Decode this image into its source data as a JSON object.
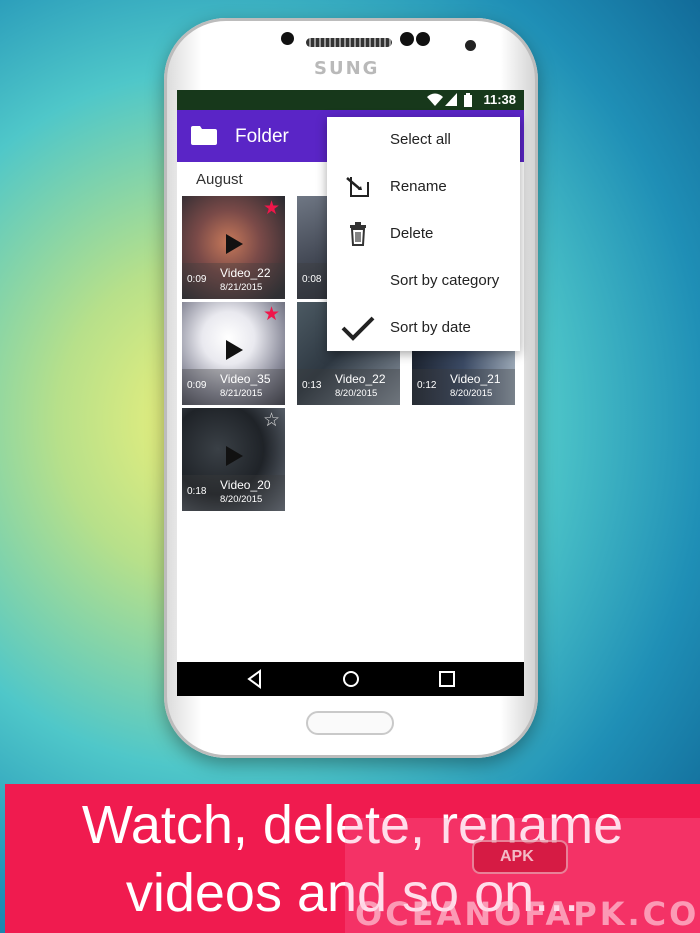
{
  "device": {
    "brand": "SUNG"
  },
  "status_bar": {
    "time": "11:38",
    "icons": [
      "wifi-icon",
      "signal-icon",
      "battery-icon"
    ]
  },
  "app_bar": {
    "title": "Folder",
    "icon": "folder-icon"
  },
  "section": {
    "label": "August"
  },
  "videos": [
    {
      "name": "Video_22",
      "date": "8/21/2015",
      "duration": "0:09",
      "starred": true
    },
    {
      "name": "",
      "date": "",
      "duration": "0:08",
      "starred": false
    },
    {
      "name": "Video_35",
      "date": "8/21/2015",
      "duration": "0:09",
      "starred": true
    },
    {
      "name": "Video_22",
      "date": "8/20/2015",
      "duration": "0:13",
      "starred": false
    },
    {
      "name": "Video_21",
      "date": "8/20/2015",
      "duration": "0:12",
      "starred": false
    },
    {
      "name": "Video_20",
      "date": "8/20/2015",
      "duration": "0:18",
      "starred": false
    }
  ],
  "menu": {
    "items": [
      {
        "label": "Select all",
        "icon": ""
      },
      {
        "label": "Rename",
        "icon": "rename-icon"
      },
      {
        "label": "Delete",
        "icon": "trash-icon"
      },
      {
        "label": "Sort by category",
        "icon": ""
      },
      {
        "label": "Sort by date",
        "icon": "checkmark-icon",
        "checked": true
      }
    ]
  },
  "nav_bar": {
    "buttons": [
      "back-icon",
      "home-icon",
      "recents-icon"
    ]
  },
  "banner": {
    "line1": "Watch, delete, rename",
    "line2": "videos and so on..."
  },
  "watermark": {
    "badge": "APK",
    "text": "OCEANOFAPK.COM"
  },
  "colors": {
    "app_bar": "#5a25c6",
    "status_bar": "#17381b",
    "star_on": "#f0164a",
    "banner": "#f01b4f"
  }
}
